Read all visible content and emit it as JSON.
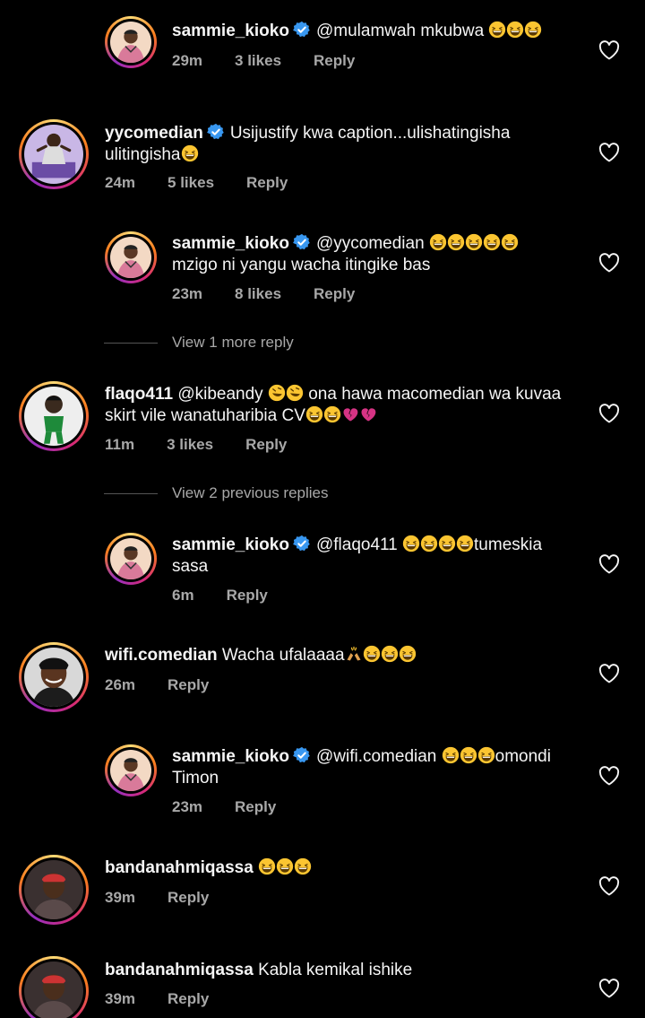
{
  "comments": [
    {
      "username": "sammie_kioko",
      "verified": true,
      "text": "@mulamwah mkubwa",
      "emoji_count": 3,
      "time": "29m",
      "likes": "3 likes",
      "reply": "Reply"
    },
    {
      "username": "yycomedian",
      "verified": true,
      "text": "Usijustify kwa caption...ulishatingisha",
      "text2": "ulitingisha",
      "emoji_count": 1,
      "time": "24m",
      "likes": "5 likes",
      "reply": "Reply"
    },
    {
      "username": "sammie_kioko",
      "verified": true,
      "text": "@yycomedian",
      "emoji_count": 5,
      "text2": "mzigo ni yangu wacha itingike bas",
      "time": "23m",
      "likes": "8 likes",
      "reply": "Reply"
    },
    {
      "username": "flaqo411",
      "verified": false,
      "text": "@kibeandy",
      "text_b": "ona hawa macomedian wa kuvaa",
      "text2": "skirt vile wanatuharibia CV",
      "time": "11m",
      "likes": "3 likes",
      "reply": "Reply"
    },
    {
      "username": "sammie_kioko",
      "verified": true,
      "text": "@flaqo411",
      "emoji_count": 4,
      "text_b": "tumeskia",
      "text2": "sasa",
      "time": "6m",
      "reply": "Reply"
    },
    {
      "username": "wifi.comedian",
      "verified": false,
      "text": "Wacha ufalaaaa",
      "emoji_count": 3,
      "time": "26m",
      "reply": "Reply"
    },
    {
      "username": "sammie_kioko",
      "verified": true,
      "text": "@wifi.comedian",
      "emoji_count": 3,
      "text_b": "omondi",
      "text2": "Timon",
      "time": "23m",
      "reply": "Reply"
    },
    {
      "username": "bandanahmiqassa",
      "verified": false,
      "text": "",
      "emoji_count": 3,
      "time": "39m",
      "reply": "Reply"
    },
    {
      "username": "bandanahmiqassa",
      "verified": false,
      "text": "Kabla kemikal ishike",
      "time": "39m",
      "reply": "Reply"
    }
  ],
  "view_more_1": "View 1 more reply",
  "view_more_2": "View 2 previous replies",
  "icons": {
    "heart": "heart-icon",
    "verified": "verified-badge-icon",
    "emoji": "grinning-squinting-face-emoji"
  },
  "colors": {
    "background": "#000000",
    "text": "#f5f5f5",
    "meta": "#a8a8a8",
    "verified": "#3897f0"
  }
}
